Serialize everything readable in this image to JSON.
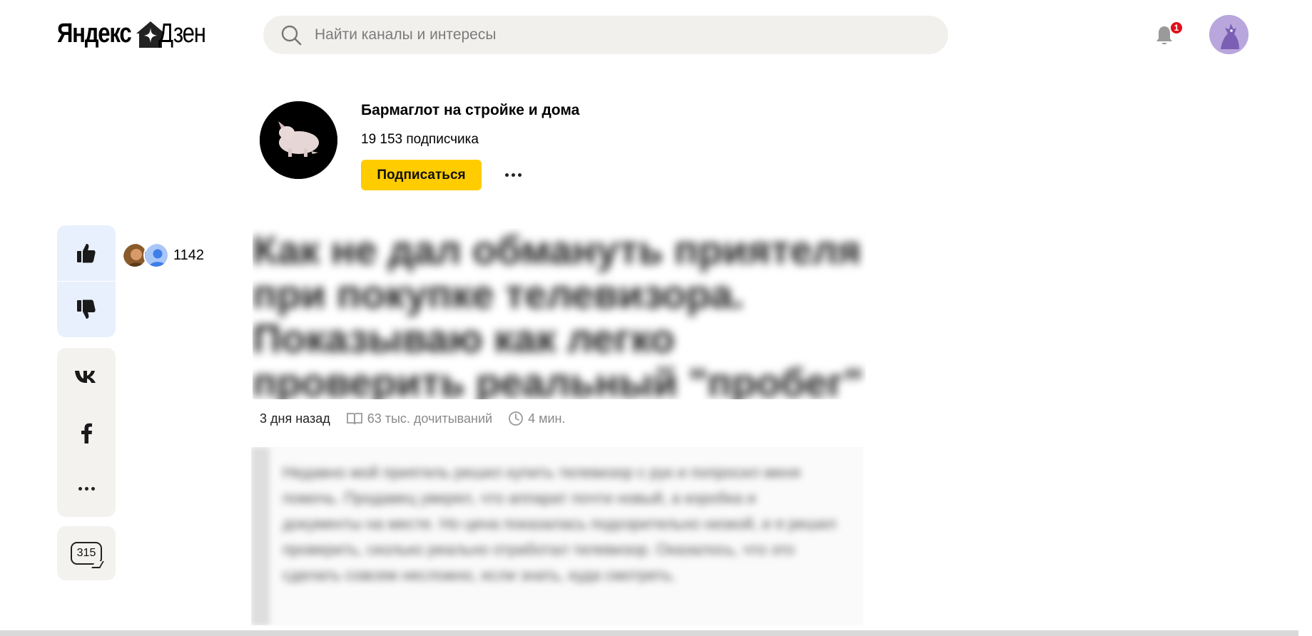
{
  "header": {
    "logo_yandex": "Яндекс",
    "logo_zen": "Дзен",
    "search_placeholder": "Найти каналы и интересы",
    "notification_count": "1"
  },
  "channel": {
    "name": "Бармаглот на стройке и дома",
    "subscribers": "19 153 подписчика",
    "subscribe_label": "Подписаться"
  },
  "reactions": {
    "like_count": "1142",
    "comment_count": "315"
  },
  "article": {
    "title": "Как не дал обмануть приятеля при покупке телевизора. Показываю как легко проверить реальный \"пробег\" аппарата",
    "date": "3 дня назад",
    "reads": "63 тыс. дочитываний",
    "read_time": "4 мин.",
    "lead": "Недавно мой приятель решил купить телевизор с рук и попросил меня помочь. Продавец уверял, что аппарат почти новый, а коробка и документы на месте. Но цена показалась подозрительно низкой, и я решил проверить, сколько реально отработал телевизор. Оказалось, что это сделать совсем несложно, если знать, куда смотреть."
  },
  "colors": {
    "accent": "#ffcc00",
    "badge": "#e0101c",
    "like_panel": "#e8f0fd",
    "panel": "#f3f2ef"
  }
}
